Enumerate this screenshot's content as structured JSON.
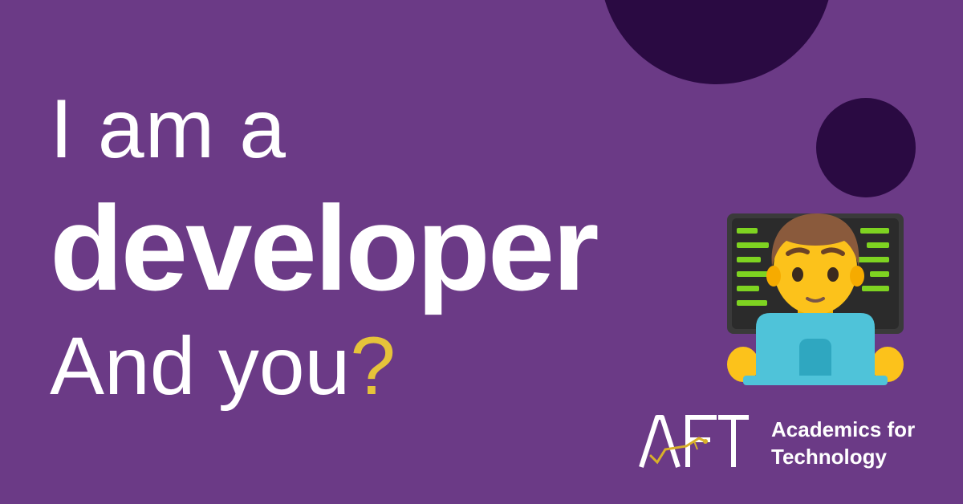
{
  "headline": {
    "line1": "I am a",
    "line2": "developer",
    "line3_text": "And you",
    "line3_mark": "?"
  },
  "brand": {
    "logo_text": "AFT",
    "name_line1": "Academics for",
    "name_line2": "Technology"
  },
  "illustration": {
    "icon": "man-technologist-emoji"
  },
  "colors": {
    "background": "#6b3a86",
    "circles": "#2a0a42",
    "text": "#ffffff",
    "accent": "#e6c33a",
    "laptop": "#4fc3d9",
    "code": "#7ed321"
  }
}
